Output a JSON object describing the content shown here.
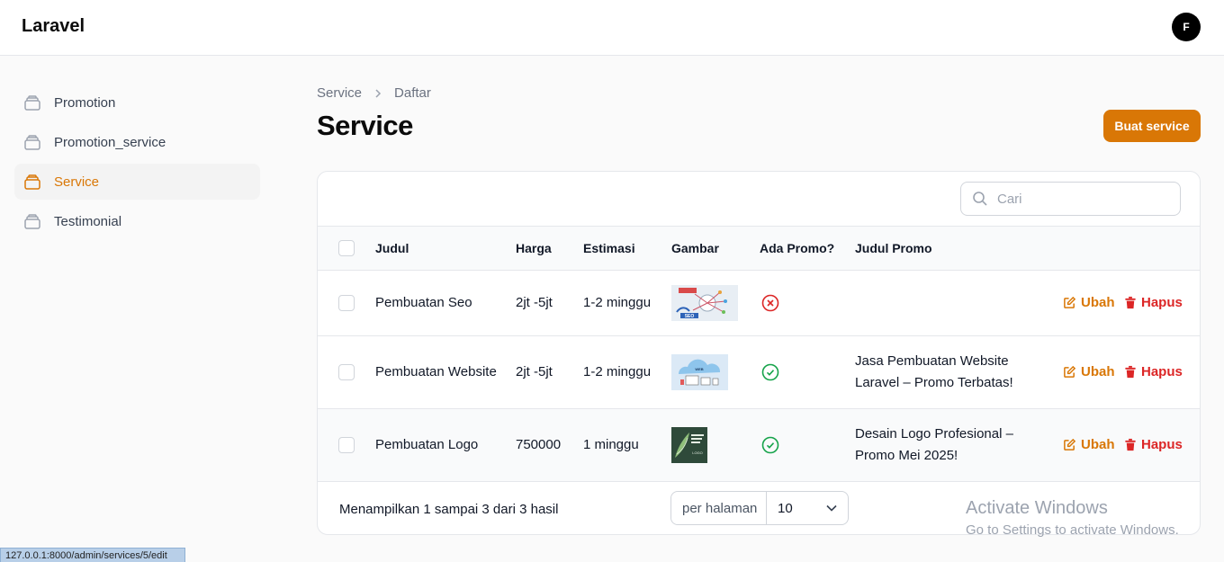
{
  "app": {
    "brand": "Laravel",
    "avatar_initial": "F"
  },
  "sidebar": {
    "items": [
      {
        "label": "Promotion",
        "active": false
      },
      {
        "label": "Promotion_service",
        "active": false
      },
      {
        "label": "Service",
        "active": true
      },
      {
        "label": "Testimonial",
        "active": false
      }
    ]
  },
  "breadcrumb": {
    "parent": "Service",
    "current": "Daftar"
  },
  "page": {
    "title": "Service",
    "create_label": "Buat service"
  },
  "search": {
    "placeholder": "Cari"
  },
  "table": {
    "headers": [
      "Judul",
      "Harga",
      "Estimasi",
      "Gambar",
      "Ada Promo?",
      "Judul Promo"
    ],
    "rows": [
      {
        "judul": "Pembuatan Seo",
        "harga": "2jt -5jt",
        "estimasi": "1-2 minggu",
        "image_label": "SEO",
        "ada_promo": false,
        "promo_line1": "",
        "promo_line2": "",
        "edit_label": "Ubah",
        "delete_label": "Hapus"
      },
      {
        "judul": "Pembuatan Website",
        "harga": "2jt -5jt",
        "estimasi": "1-2 minggu",
        "image_label": "WEB",
        "ada_promo": true,
        "promo_line1": "Jasa Pembuatan Website",
        "promo_line2": "Laravel – Promo Terbatas!",
        "edit_label": "Ubah",
        "delete_label": "Hapus"
      },
      {
        "judul": "Pembuatan Logo",
        "harga": "750000",
        "estimasi": "1 minggu",
        "image_label": "LOGO",
        "ada_promo": true,
        "promo_line1": "Desain Logo Profesional –",
        "promo_line2": "Promo Mei 2025!",
        "edit_label": "Ubah",
        "delete_label": "Hapus"
      }
    ]
  },
  "footer": {
    "summary": "Menampilkan 1 sampai 3 dari 3 hasil",
    "per_page_label": "per halaman",
    "per_page_value": "10"
  },
  "watermark": {
    "line1": "Activate Windows",
    "line2": "Go to Settings to activate Windows."
  },
  "statusbar": {
    "url": "127.0.0.1:8000/admin/services/5/edit"
  },
  "colors": {
    "accent": "#d97706",
    "danger": "#dc2626",
    "success": "#16a34a"
  },
  "icons": {
    "nav": "rectangle-stack-icon",
    "search": "search-icon",
    "chevron": "chevron-down-icon",
    "edit": "pencil-square-icon",
    "delete": "trash-icon",
    "promo_yes": "check-circle-icon",
    "promo_no": "x-circle-icon"
  }
}
